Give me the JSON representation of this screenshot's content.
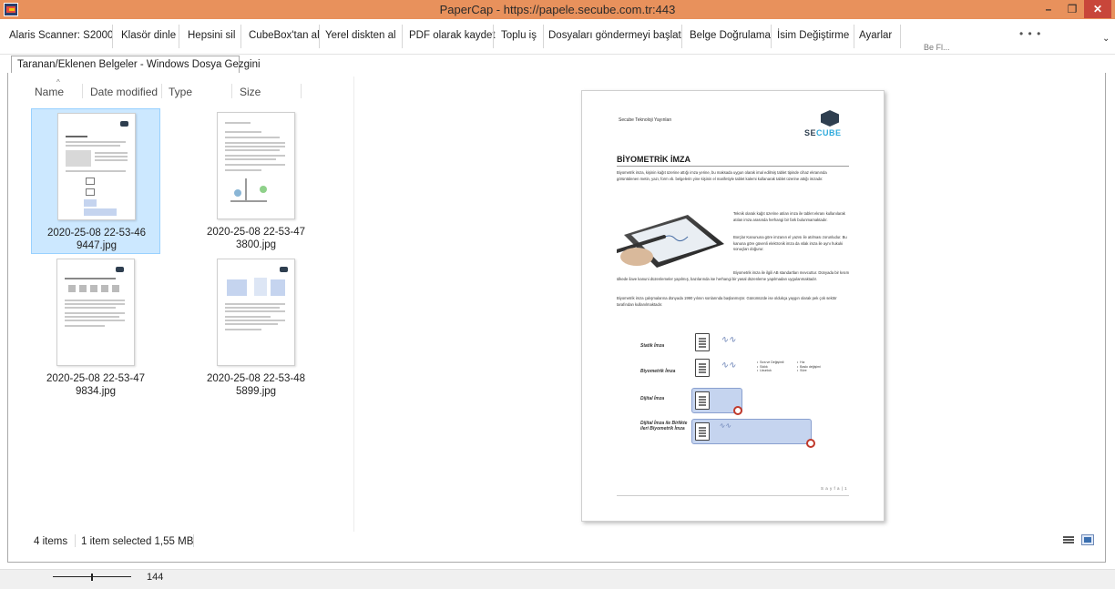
{
  "window": {
    "title": "PaperCap - https://papele.secube.com.tr:443",
    "minimize": "–",
    "maximize": "❐",
    "close": "✕"
  },
  "toolbar": {
    "items": [
      "Alaris Scanner: S2000",
      "Klasör dinle",
      "Hepsini sil",
      "CubeBox'tan al",
      "Yerel diskten al",
      "PDF olarak kaydet",
      "Toplu iş",
      "Dosyaları göndermeyi başlat",
      "Belge Doğrulama",
      "İsim Değiştirme",
      "Ayarlar"
    ],
    "more": "• • •",
    "overflow_hint": "Be Fl...",
    "chevron": "⌄"
  },
  "tab": {
    "label": "Taranan/Eklenen Belgeler - Windows Dosya Gezgini"
  },
  "explorer": {
    "columns": [
      "Name",
      "Date modified",
      "Type",
      "Size"
    ],
    "sort_indicator": "^",
    "files": [
      {
        "line1": "2020-25-08 22-53-46",
        "line2": "9447.jpg",
        "selected": true
      },
      {
        "line1": "2020-25-08 22-53-47",
        "line2": "3800.jpg",
        "selected": false
      },
      {
        "line1": "2020-25-08 22-53-47",
        "line2": "9834.jpg",
        "selected": false
      },
      {
        "line1": "2020-25-08 22-53-48",
        "line2": "5899.jpg",
        "selected": false
      }
    ],
    "status": {
      "items": "4 items",
      "selected": "1 item selected  1,55 MB"
    }
  },
  "preview": {
    "company": "Secube Teknoloji Yayınları",
    "logo_main": "SE",
    "logo_accent": "CUBE",
    "heading": "BİYOMETRİK İMZA",
    "intro": "Biyometrik imza, kişinin kağıt üzerine attığı imza yerine, bu maksada uygun olarak imal edilmiş tablet tipinde cihaz ekranında görüntülenen metin, yazı, form vb. belgelerin yine kişinin el marifetiyle tablet kalemi kullanarak tablet üzerine attığı imzadır.",
    "para1": "Teknik olarak kağıt üzerine atılan imza ile tablet ekranı kullanılarak atılan imza arasında herhangi bir fark bulunmamaktadır.",
    "para2": "Borçlar Kanununa göre imzanın el yazısı ile atılması zorunludur. Bu kanuna göre güvenli elektronik imza da ıslak imza ile aynı hukuki sonuçları doğurur.",
    "para3": "Biyometrik imza ile ilgili AB standartları mevcuttur. Dünyada bir kısım ülkede ilave kanuni düzenlemeler yapılmış, bazılarında ise herhangi bir yasal düzenleme yapılmadan uygulanmaktadır.",
    "para4": "Biyometrik imza çalışmalarına dünyada 1990 yılının sonlarında başlanmıştır. Günümüzde ise oldukça yaygın olarak pek çok sektör tarafından kullanılmaktadır.",
    "rows": [
      {
        "label": "Statik İmza"
      },
      {
        "label": "Biyometrik İmza"
      },
      {
        "label": "Dijital İmza"
      },
      {
        "label": "Dijital İmza ile Birlikte ileri Biyometrik İmza"
      }
    ],
    "bullets_a": "•  Sıra ve Değişimli\n•  Sıklık\n•  Uzunluk",
    "bullets_b": "•  Hız\n•  Baskı değişimi\n•  Süre",
    "page_label": "S a y f a | 1"
  },
  "zoom": {
    "value": "144",
    "level_fraction": 0.5
  }
}
